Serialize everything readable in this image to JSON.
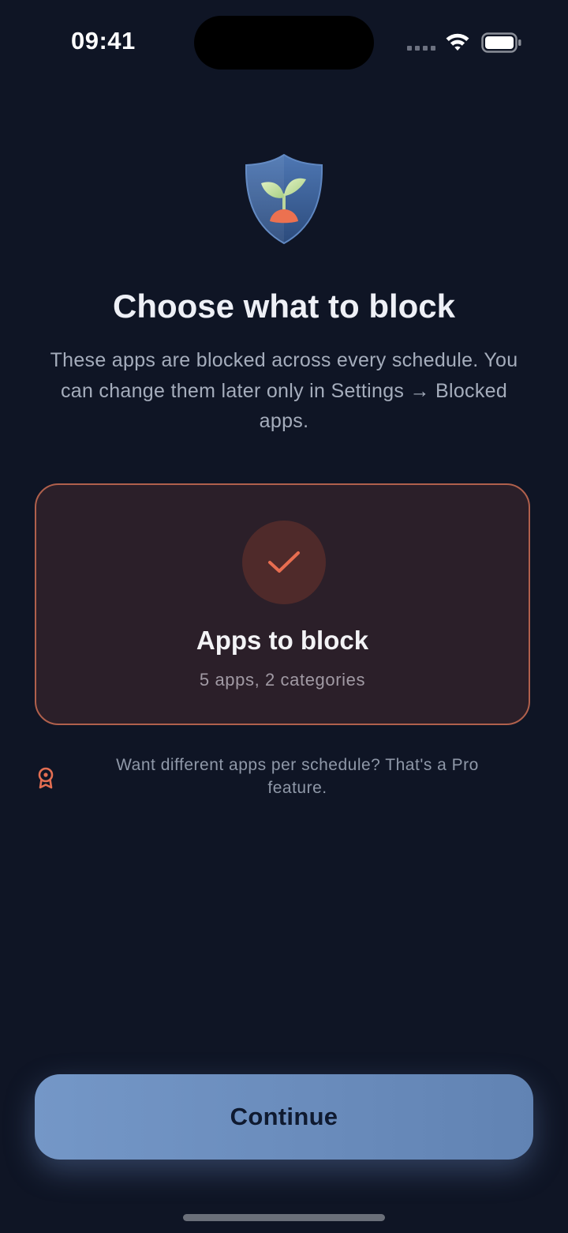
{
  "status_bar": {
    "time": "09:41"
  },
  "header": {
    "logo_icon": "shield-sprout-icon",
    "title": "Choose what to block",
    "subtitle": "These apps are blocked across every schedule. You can change them later only in Settings → Blocked apps."
  },
  "selection_card": {
    "icon": "checkmark-icon",
    "title": "Apps to block",
    "summary": "5 apps, 2 categories",
    "selected": true
  },
  "pro_note": {
    "icon": "award-icon",
    "text": "Want different apps per schedule? That's a Pro feature."
  },
  "footer": {
    "continue_label": "Continue"
  },
  "colors": {
    "background": "#0f1525",
    "accent": "#e36e52",
    "card_background": "#2b1f29",
    "card_border": "#b0604c",
    "button": "#6a8cbc",
    "button_text": "#0f1a30"
  }
}
